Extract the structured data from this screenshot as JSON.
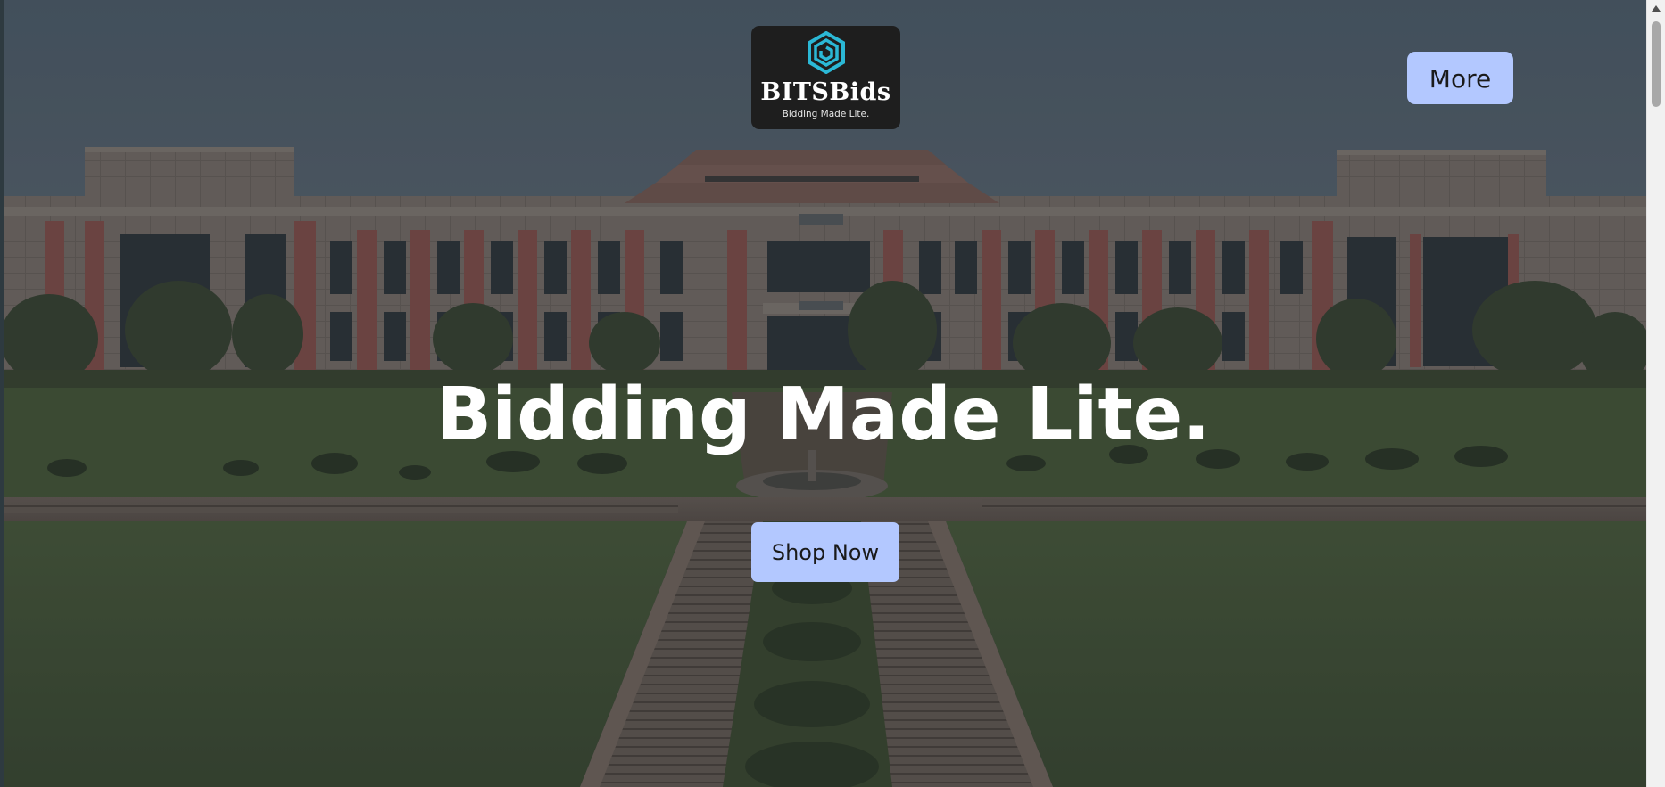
{
  "brand": {
    "name": "BITSBids",
    "tagline": "Bidding Made Lite.",
    "logo_icon": "hexagon-spiral-icon",
    "logo_color": "#2bb8d6",
    "logo_background": "#1e1e1e"
  },
  "nav": {
    "more_label": "More"
  },
  "hero": {
    "headline": "Bidding Made Lite.",
    "cta_label": "Shop Now",
    "background_image": "campus-building-photo"
  },
  "colors": {
    "button_bg": "#b3c8ff",
    "button_text": "#1a1a1a",
    "headline": "#ffffff"
  }
}
